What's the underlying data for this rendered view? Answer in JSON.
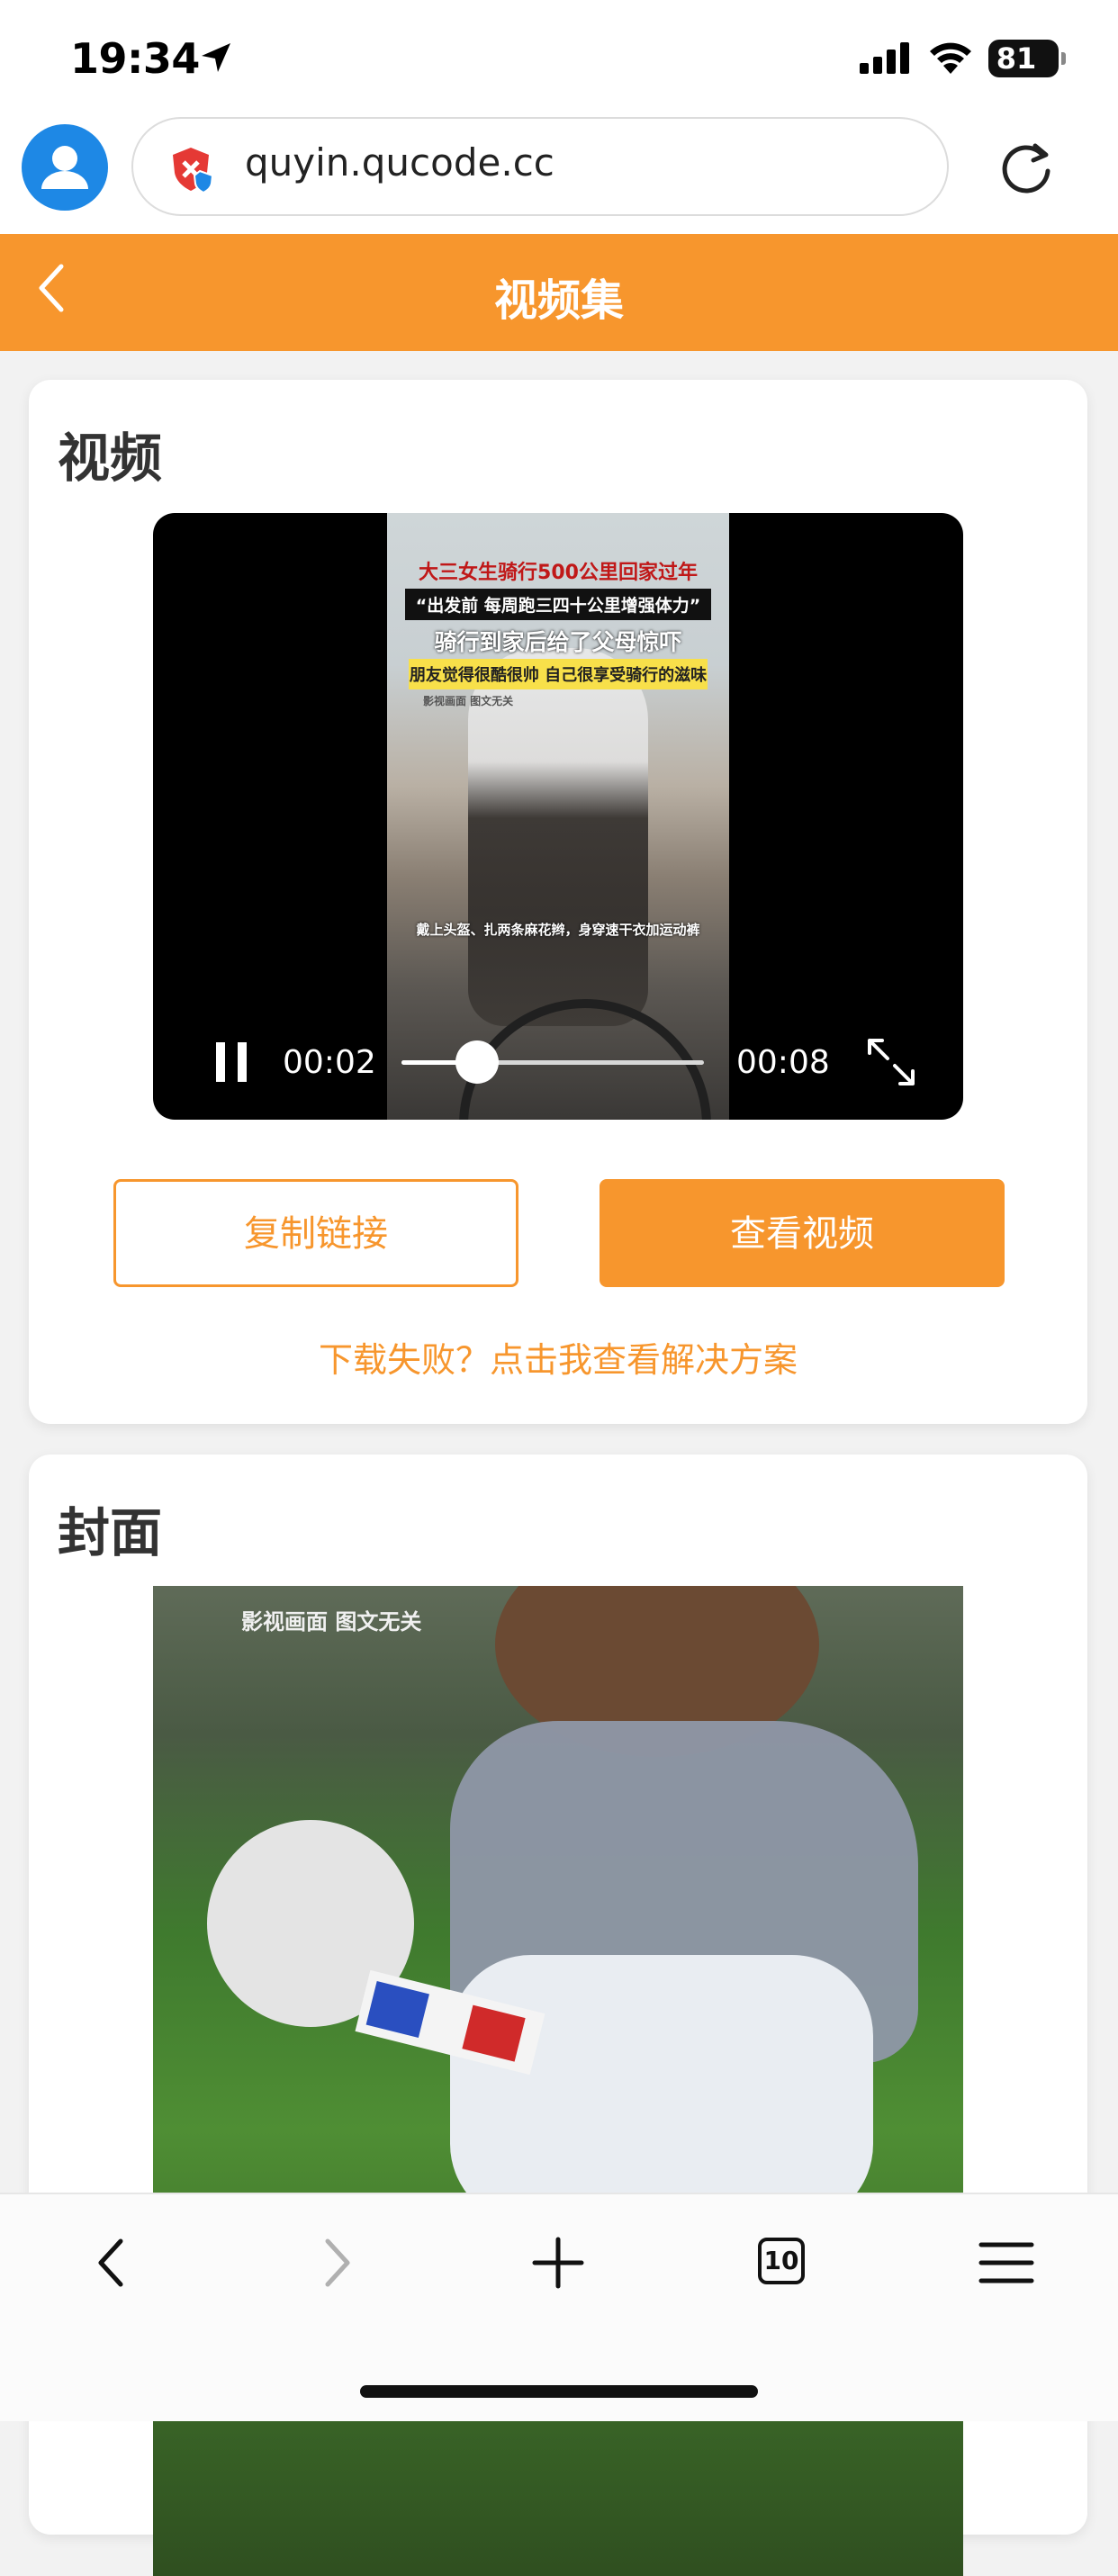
{
  "status_bar": {
    "time": "19:34",
    "battery": "81",
    "icons": [
      "location-arrow-icon",
      "cellular-signal-icon",
      "wifi-icon",
      "battery-icon"
    ]
  },
  "address_bar": {
    "url": "quyin.qucode.cc",
    "icons": [
      "profile-avatar-icon",
      "security-shield-icon",
      "reload-icon"
    ]
  },
  "header": {
    "title": "视频集",
    "back_icon": "chevron-left-icon"
  },
  "video_card": {
    "title": "视频",
    "player": {
      "captions": [
        "大三女生骑行500公里回家过年",
        "“出发前 每周跑三四十公里增强体力”",
        "骑行到家后给了父母惊吓",
        "朋友觉得很酷很帅 自己很享受骑行的滋味",
        "影视画面 图文无关",
        "戴上头盔、扎两条麻花辫，身穿速干衣加运动裤"
      ],
      "current_time": "00:02",
      "duration": "00:08",
      "progress_fraction": 0.25,
      "state": "playing"
    },
    "copy_button": "复制链接",
    "view_button": "查看视频",
    "help_link": "下载失败？点击我查看解决方案"
  },
  "cover_card": {
    "title": "封面",
    "cover_watermark": "影视画面 图文无关"
  },
  "toolbar": {
    "tab_count": "10",
    "icons": [
      "back-icon",
      "forward-icon",
      "new-tab-plus-icon",
      "tabs-icon",
      "menu-icon"
    ]
  },
  "colors": {
    "accent": "#f7962d",
    "background": "#f2f2f2",
    "card": "#ffffff"
  }
}
